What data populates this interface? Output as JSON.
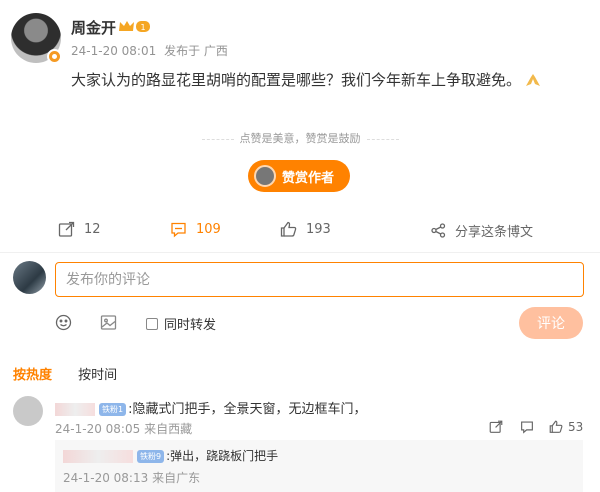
{
  "post": {
    "author": "周金开",
    "time": "24-1-20 08:01",
    "source": "发布于 广西",
    "text": "大家认为的路显花里胡哨的配置是哪些？我们今年新车上争取避免。"
  },
  "reward": {
    "tip": "点赞是美意，赞赏是鼓励",
    "button_label": "赞赏作者"
  },
  "actions": {
    "repost_count": "12",
    "comment_count": "109",
    "like_count": "193",
    "share_label": "分享这条博文"
  },
  "composer": {
    "placeholder": "发布你的评论",
    "repost_label": "同时转发",
    "submit_label": "评论"
  },
  "sort": {
    "hot": "按热度",
    "time": "按时间"
  },
  "comments": [
    {
      "badge": "铁粉1",
      "text": ":隐藏式门把手，全景天窗，无边框车门，",
      "time": "24-1-20 08:05",
      "location": "来自西藏",
      "likes": "53"
    }
  ],
  "reply": {
    "badge": "铁粉9",
    "text": ":弹出，跷跷板门把手",
    "time": "24-1-20 08:13",
    "location": "来自广东"
  },
  "colors": {
    "accent": "#ff8200",
    "submit_disabled": "#ffc09f"
  }
}
